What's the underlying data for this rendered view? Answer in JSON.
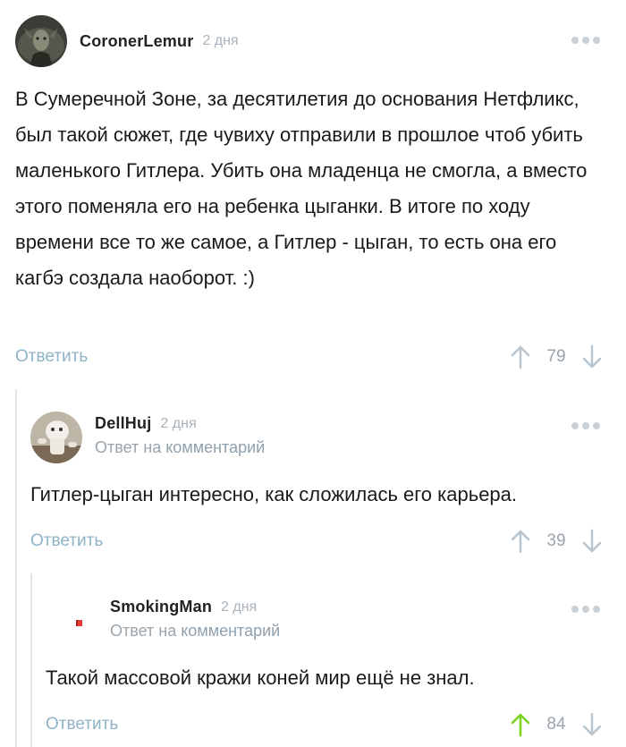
{
  "colors": {
    "reply_link": "#8fb3c9",
    "muted": "#9aa4ad",
    "thread_line": "#e2e6e9",
    "vote_active": "#7ed321",
    "vote_inactive": "#b7c4cd"
  },
  "comments": [
    {
      "username": "CoronerLemur",
      "time": "2 дня",
      "text": "В Сумеречной Зоне, за десятилетия до основания Нетфликс, был такой сюжет, где чувиху отправили в прошлое чтоб убить маленького Гитлера. Убить она младенца не смогла, а вместо этого поменяла его на ребенка цыганки. В итоге по ходу времени все то же самое, а Гитлер - цыган, то есть она его кагбэ создала наоборот. :)",
      "reply_label": "Ответить",
      "rating": "79",
      "upvoted": false
    },
    {
      "username": "DellHuj",
      "time": "2 дня",
      "reply_prefix": "Ответ на",
      "reply_link": "комментарий",
      "text": "Гитлер-цыган интересно, как сложилась его карьера.",
      "reply_label": "Ответить",
      "rating": "39",
      "upvoted": false
    },
    {
      "username": "SmokingMan",
      "time": "2 дня",
      "reply_prefix": "Ответ на",
      "reply_link": "комментарий",
      "text": "Такой массовой кражи коней мир ещё не знал.",
      "reply_label": "Ответить",
      "rating": "84",
      "upvoted": true
    }
  ]
}
